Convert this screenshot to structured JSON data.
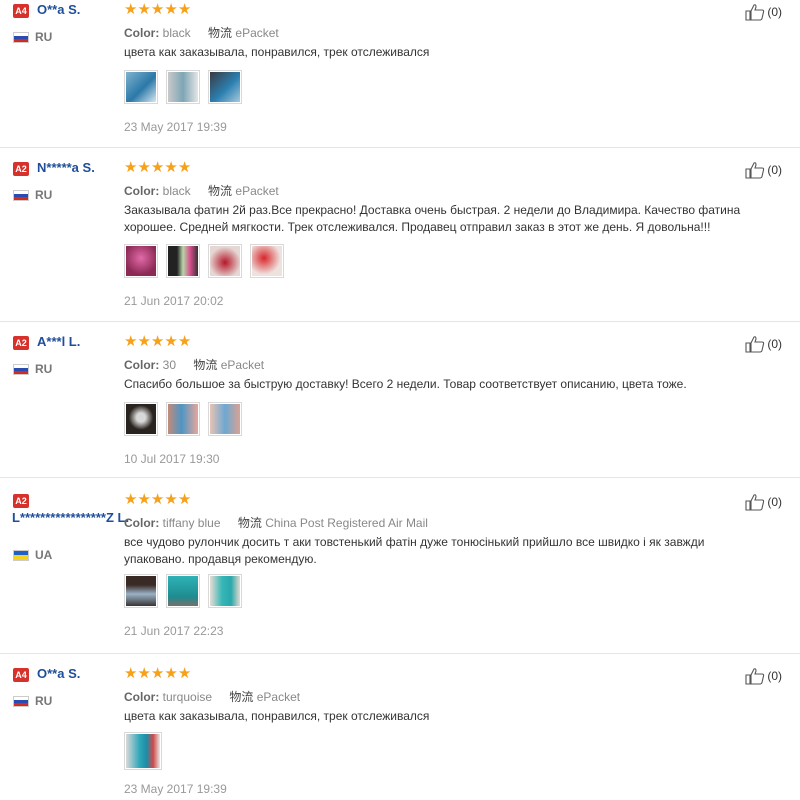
{
  "reviews": [
    {
      "level": "A4",
      "name": "O**a S.",
      "country": "RU",
      "color_label": "Color:",
      "color": "black",
      "shipping_cn": "物流",
      "shipping": "ePacket",
      "text": "цвета как заказывала, понравился, трек отслеживался",
      "date": "23 May 2017 19:39",
      "helpful": "(0)",
      "photos": 3
    },
    {
      "level": "A2",
      "name": "N*****a S.",
      "country": "RU",
      "color_label": "Color:",
      "color": "black",
      "shipping_cn": "物流",
      "shipping": "ePacket",
      "text": "Заказывала фатин 2й раз.Все прекрасно! Доставка очень быстрая. 2 недели до Владимира. Качество фатина хорошее. Средней мягкости. Трек отслеживался. Продавец отправил заказ в этот же день. Я довольна!!!",
      "date": "21 Jun 2017 20:02",
      "helpful": "(0)",
      "photos": 4
    },
    {
      "level": "A2",
      "name": "A***l L.",
      "country": "RU",
      "color_label": "Color:",
      "color": "30",
      "shipping_cn": "物流",
      "shipping": "ePacket",
      "text": "Спасибо большое за быструю доставку! Всего 2 недели. Товар соответствует описанию, цвета тоже.",
      "date": "10 Jul 2017 19:30",
      "helpful": "(0)",
      "photos": 3
    },
    {
      "level": "A2",
      "name": "L*****************Z L.",
      "country": "UA",
      "color_label": "Color:",
      "color": "tiffany blue",
      "shipping_cn": "物流",
      "shipping": "China Post Registered Air Mail",
      "text": "все чудово рулончик досить т аки товстенький фатін дуже тонюсінький прийшло все швидко і як завжди упаковано. продавця рекомендую.",
      "date": "21 Jun 2017 22:23",
      "helpful": "(0)",
      "photos": 3
    },
    {
      "level": "A4",
      "name": "O**a S.",
      "country": "RU",
      "color_label": "Color:",
      "color": "turquoise",
      "shipping_cn": "物流",
      "shipping": "ePacket",
      "text": "цвета как заказывала, понравился, трек отслеживался",
      "date": "23 May 2017 19:39",
      "helpful": "(0)",
      "photos": 1
    }
  ],
  "colors": {
    "star": "#f7a11a",
    "badge": "#d6312b",
    "name": "#1e4e9a"
  },
  "icons": {
    "rating": "star-icon",
    "like": "thumbs-up-icon",
    "flag_ru": "flag-russia-icon",
    "flag_ua": "flag-ukraine-icon"
  }
}
